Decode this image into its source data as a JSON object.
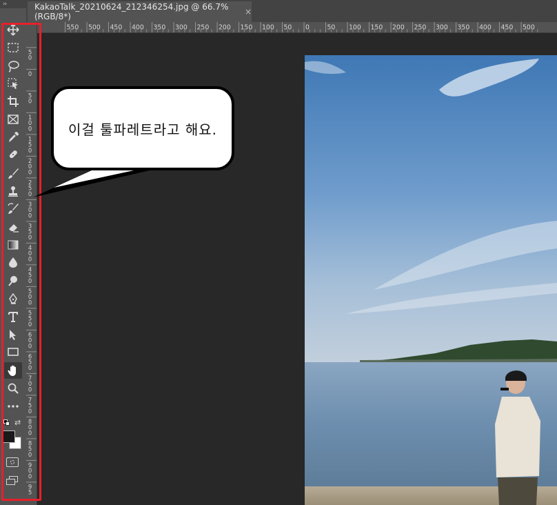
{
  "document_tab": {
    "title": "KakaoTalk_20210624_212346254.jpg @ 66.7% (RGB/8*)",
    "close_glyph": "×"
  },
  "panel_collapse_glyph": "››",
  "ruler_horizontal": {
    "labels": [
      "550",
      "500",
      "450",
      "400",
      "350",
      "300",
      "250",
      "200",
      "150",
      "100",
      "50",
      "0",
      "50",
      "100",
      "150",
      "200",
      "250",
      "300",
      "350",
      "400",
      "450",
      "500"
    ]
  },
  "ruler_vertical": {
    "labels": [
      "50",
      "0",
      "50",
      "100",
      "150",
      "200",
      "250",
      "300",
      "350",
      "400",
      "450",
      "500",
      "550",
      "600",
      "650",
      "700",
      "750",
      "800",
      "850",
      "900",
      "95"
    ]
  },
  "toolbar": {
    "tools": [
      {
        "name": "move-tool",
        "icon": "move-icon"
      },
      {
        "name": "rectangular-marquee-tool",
        "icon": "marquee-icon"
      },
      {
        "name": "lasso-tool",
        "icon": "lasso-icon"
      },
      {
        "name": "object-selection-tool",
        "icon": "object-selection-icon"
      },
      {
        "name": "crop-tool",
        "icon": "crop-icon"
      },
      {
        "name": "frame-tool",
        "icon": "frame-icon"
      },
      {
        "name": "eyedropper-tool",
        "icon": "eyedropper-icon"
      },
      {
        "name": "healing-brush-tool",
        "icon": "bandage-icon"
      },
      {
        "name": "brush-tool",
        "icon": "brush-icon"
      },
      {
        "name": "clone-stamp-tool",
        "icon": "stamp-icon"
      },
      {
        "name": "history-brush-tool",
        "icon": "history-brush-icon"
      },
      {
        "name": "eraser-tool",
        "icon": "eraser-icon"
      },
      {
        "name": "gradient-tool",
        "icon": "gradient-icon"
      },
      {
        "name": "blur-tool",
        "icon": "droplet-icon"
      },
      {
        "name": "dodge-tool",
        "icon": "dodge-icon"
      },
      {
        "name": "pen-tool",
        "icon": "pen-icon"
      },
      {
        "name": "type-tool",
        "icon": "type-icon"
      },
      {
        "name": "path-selection-tool",
        "icon": "arrow-cursor-icon"
      },
      {
        "name": "rectangle-tool",
        "icon": "rectangle-icon"
      },
      {
        "name": "hand-tool",
        "icon": "hand-icon",
        "active": true
      },
      {
        "name": "zoom-tool",
        "icon": "magnifier-icon"
      },
      {
        "name": "edit-toolbar",
        "icon": "ellipsis-icon"
      }
    ],
    "foreground_color": "#1a1a1a",
    "background_color": "#ffffff"
  },
  "annotation": {
    "bubble_text": "이걸 툴파레트라고 해요.",
    "highlight_color": "#e8202a"
  }
}
